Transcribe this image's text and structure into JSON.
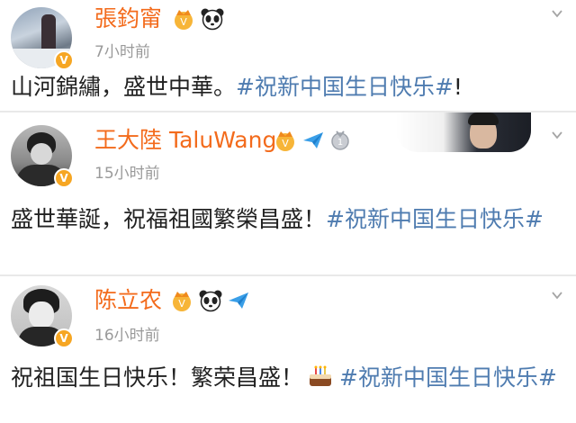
{
  "posts": [
    {
      "author": "張鈞甯",
      "time": "7小时前",
      "text": "山河錦繡，盛世中華。",
      "topic": "#祝新中国生日快乐#",
      "suffix": "!"
    },
    {
      "author": "王大陸 TaluWang",
      "time": "15小时前",
      "text": "盛世華誕，祝福祖國繁榮昌盛！",
      "topic": "#祝新中国生日快乐#",
      "suffix": ""
    },
    {
      "author": "陈立农",
      "time": "16小时前",
      "text": "祝祖国生日快乐！繁荣昌盛！",
      "emoji": "birthday-cake",
      "topic": "#祝新中国生日快乐#",
      "suffix": ""
    }
  ],
  "colors": {
    "name": "#f36b1c",
    "topic": "#4f7cb0",
    "time": "#9a9a9a",
    "verified": "#f6a623",
    "forward_arrow": "#3a9fe8"
  },
  "icons": [
    "crown-badge-icon",
    "panda-icon",
    "paper-plane-icon",
    "medal-icon",
    "chevron-down-icon",
    "birthday-cake-icon"
  ]
}
